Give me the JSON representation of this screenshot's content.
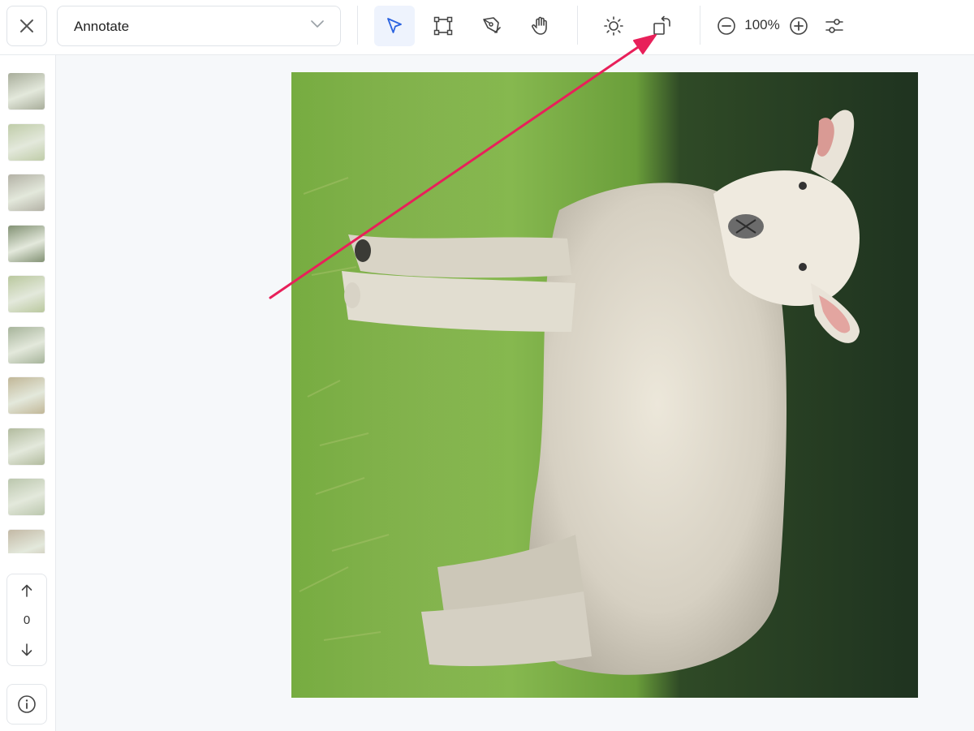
{
  "toolbar": {
    "mode_select": {
      "value": "Annotate"
    },
    "zoom": {
      "value": "100%"
    },
    "tools": [
      {
        "name": "select-tool",
        "icon": "cursor-arrow-icon",
        "active": true
      },
      {
        "name": "bounding-box-tool",
        "icon": "bounding-box-icon",
        "active": false
      },
      {
        "name": "pen-tool",
        "icon": "pen-nib-icon",
        "active": false
      },
      {
        "name": "pan-tool",
        "icon": "hand-icon",
        "active": false
      },
      {
        "name": "brightness-tool",
        "icon": "sun-icon",
        "active": false
      },
      {
        "name": "rotate-tool",
        "icon": "rotate-icon",
        "active": false
      },
      {
        "name": "zoom-out-button",
        "icon": "zoom-out-icon",
        "active": false
      },
      {
        "name": "zoom-in-button",
        "icon": "zoom-in-icon",
        "active": false
      },
      {
        "name": "adjustments-button",
        "icon": "sliders-icon",
        "active": false
      }
    ]
  },
  "sidebar": {
    "thumbnails": [
      {
        "name": "thumbnail-1",
        "color": "#9aa08a"
      },
      {
        "name": "thumbnail-2",
        "color": "#b5c49a"
      },
      {
        "name": "thumbnail-3",
        "color": "#a7a597"
      },
      {
        "name": "thumbnail-4",
        "color": "#6d7f5c"
      },
      {
        "name": "thumbnail-5",
        "color": "#aebf8e"
      },
      {
        "name": "thumbnail-6",
        "color": "#98a88a"
      },
      {
        "name": "thumbnail-7",
        "color": "#b7ab86"
      },
      {
        "name": "thumbnail-8",
        "color": "#a5b08e"
      },
      {
        "name": "thumbnail-9",
        "color": "#b0bea0"
      },
      {
        "name": "thumbnail-10",
        "color": "#b9ad96"
      }
    ],
    "pager": {
      "count": "0"
    }
  },
  "annotation_arrow": {
    "color": "#e8205a"
  },
  "canvas": {
    "accent": "#3b6fe0"
  }
}
